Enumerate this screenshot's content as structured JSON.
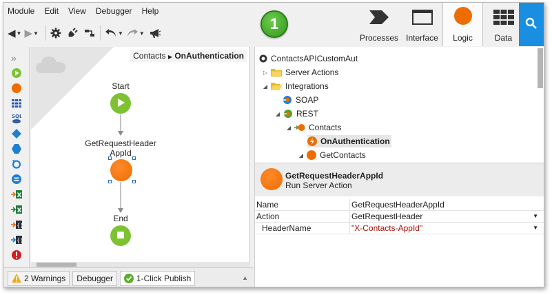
{
  "menu": [
    "Module",
    "Edit",
    "View",
    "Debugger",
    "Help"
  ],
  "publish_badge": "1",
  "tabs": [
    {
      "label": "Processes",
      "icon": "processes-icon"
    },
    {
      "label": "Interface",
      "icon": "interface-icon"
    },
    {
      "label": "Logic",
      "icon": "logic-icon",
      "active": true
    },
    {
      "label": "Data",
      "icon": "data-icon"
    }
  ],
  "breadcrumb": {
    "parent": "Contacts",
    "current": "OnAuthentication"
  },
  "flow": {
    "start_label": "Start",
    "action_label_line1": "GetRequestHeader",
    "action_label_line2": "AppId",
    "end_label": "End"
  },
  "status_tabs": {
    "warnings": "2 Warnings",
    "debugger": "Debugger",
    "publish": "1-Click Publish"
  },
  "tree": {
    "root": "ContactsAPICustomAut",
    "server_actions": "Server Actions",
    "integrations": "Integrations",
    "soap": "SOAP",
    "rest": "REST",
    "contacts": "Contacts",
    "on_auth": "OnAuthentication",
    "get_contacts": "GetContacts"
  },
  "properties": {
    "title": "GetRequestHeaderAppId",
    "subtitle": "Run Server Action",
    "rows": [
      {
        "key": "Name",
        "value": "GetRequestHeaderAppId"
      },
      {
        "key": "Action",
        "value": "GetRequestHeader"
      },
      {
        "key": "HeaderName",
        "value": "\"X-Contacts-AppId\""
      }
    ]
  },
  "colors": {
    "accent_blue": "#1a8ee0",
    "logic_orange": "#ee6d00",
    "flow_green": "#7ec232",
    "publish_green": "#33961c"
  }
}
